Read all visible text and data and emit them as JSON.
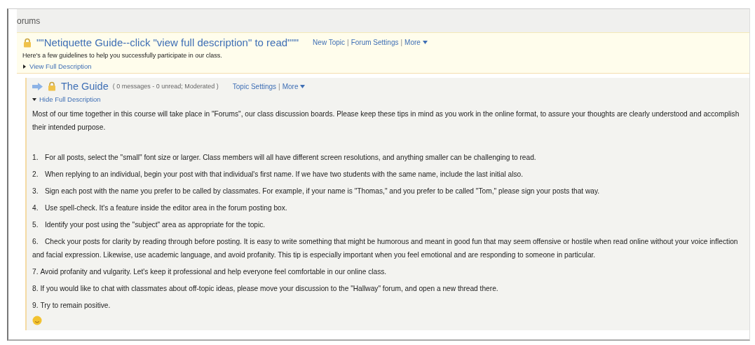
{
  "header": {
    "title": "orums"
  },
  "forum": {
    "title": "\"\"Netiquette Guide--click \"view full description\" to read\"\"\"",
    "actions": [
      {
        "kind": "link",
        "label": "New Topic"
      },
      {
        "kind": "separator",
        "label": "|"
      },
      {
        "kind": "link",
        "label": "Forum Settings"
      },
      {
        "kind": "separator",
        "label": "|"
      },
      {
        "kind": "menu",
        "label": "More"
      }
    ],
    "description": "Here's a few guidelines to help you successfully participate in our class.",
    "toggle": {
      "label": "View Full Description",
      "expanded": false
    }
  },
  "topic": {
    "title": "The Guide",
    "meta": "( 0 messages - 0 unread; Moderated )",
    "actions": [
      {
        "kind": "link",
        "label": "Topic Settings"
      },
      {
        "kind": "separator",
        "label": "|"
      },
      {
        "kind": "menu",
        "label": "More"
      }
    ],
    "toggle": {
      "label": "Hide Full Description",
      "expanded": true
    },
    "intro": "Most of our time together in this course will take place in \"Forums\", our class discussion boards. Please keep these tips in mind as you work in the online format, to assure your thoughts are clearly understood and accomplish their intended purpose.",
    "items": [
      {
        "kind": "tabbed",
        "number": "1.",
        "text": "For all posts, select the \"small\" font size or larger. Class members will all have different screen resolutions, and anything smaller can be challenging to read."
      },
      {
        "kind": "tabbed",
        "number": "2.",
        "text": "When replying to an individual, begin your post with that individual's first name. If we have two students with the same name, include the last initial also."
      },
      {
        "kind": "tabbed",
        "number": "3.",
        "text": "Sign each post with the name you prefer to be called by classmates. For example, if your name is \"Thomas,\" and you prefer to be called \"Tom,\" please sign your posts that way."
      },
      {
        "kind": "tabbed",
        "number": "4.",
        "text": "Use spell-check. It's a feature inside the editor area in the forum posting box."
      },
      {
        "kind": "tabbed",
        "number": "5.",
        "text": "Identify your post using the \"subject\" area as appropriate for the topic."
      },
      {
        "kind": "tabbed",
        "number": "6.",
        "text": "Check your posts for clarity by reading through before posting. It is easy to write something that might be humorous and meant in good fun that may seem offensive or hostile when read online without your voice inflection and facial expression. Likewise, use academic language, and avoid profanity. This tip is especially important when you feel emotional and are responding to someone in particular."
      },
      {
        "kind": "plain",
        "number": "7.",
        "text": "Avoid profanity and vulgarity. Let's keep it professional and help everyone feel comfortable in our online class."
      },
      {
        "kind": "plain",
        "number": "8.",
        "text": "If you would like to chat with classmates about off-topic ideas, please move your discussion to the \"Hallway\" forum, and open a new thread there."
      },
      {
        "kind": "plain",
        "number": "9.",
        "text": "Try to remain positive."
      }
    ]
  }
}
